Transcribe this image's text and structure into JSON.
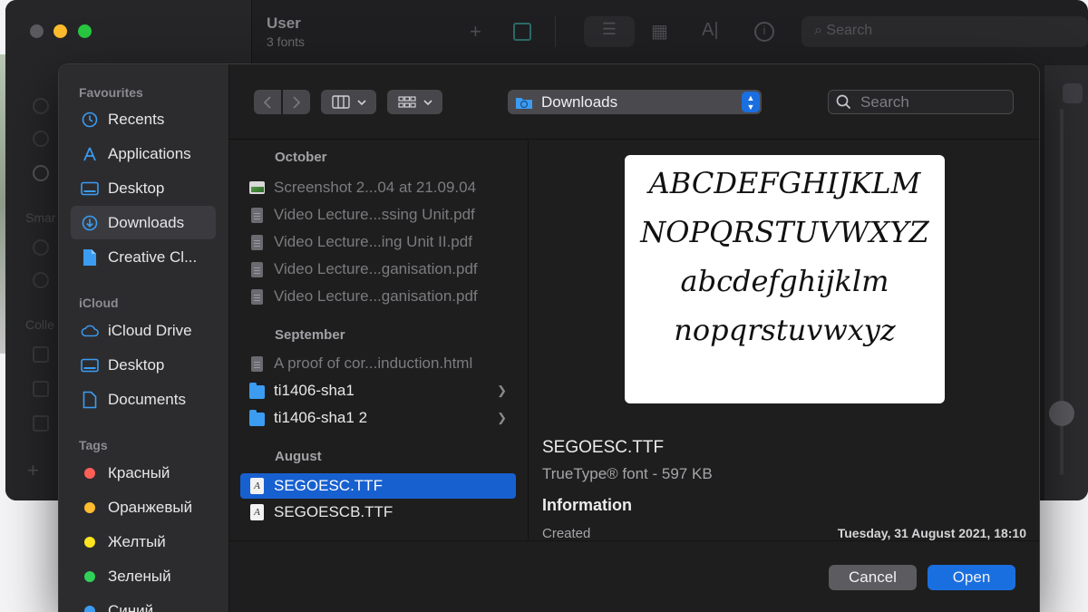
{
  "background_window": {
    "title": "User",
    "subtitle": "3 fonts",
    "search_placeholder": "Search"
  },
  "dialog": {
    "sidebar": {
      "sections": [
        {
          "label": "Favourites",
          "items": [
            {
              "label": "Recents",
              "icon": "clock-icon"
            },
            {
              "label": "Applications",
              "icon": "applications-icon"
            },
            {
              "label": "Desktop",
              "icon": "desktop-icon"
            },
            {
              "label": "Downloads",
              "icon": "downloads-icon",
              "selected": true
            },
            {
              "label": "Creative Cl...",
              "icon": "file-icon"
            }
          ]
        },
        {
          "label": "iCloud",
          "items": [
            {
              "label": "iCloud Drive",
              "icon": "cloud-icon"
            },
            {
              "label": "Desktop",
              "icon": "desktop-icon"
            },
            {
              "label": "Documents",
              "icon": "document-icon"
            }
          ]
        },
        {
          "label": "Tags",
          "items": [
            {
              "label": "Красный",
              "color": "#ff5f57"
            },
            {
              "label": "Оранжевый",
              "color": "#febc2e"
            },
            {
              "label": "Желтый",
              "color": "#ffe41f"
            },
            {
              "label": "Зеленый",
              "color": "#30d158"
            },
            {
              "label": "Синий",
              "color": "#3b9cf2"
            }
          ]
        }
      ]
    },
    "toolbar": {
      "back_icon": "chevron-left-icon",
      "forward_icon": "chevron-right-icon",
      "view_icon": "columns-view-icon",
      "group_icon": "grid-icon",
      "location": "Downloads",
      "search_placeholder": "Search"
    },
    "file_list": {
      "groups": [
        {
          "label": "October",
          "files": [
            {
              "name": "Screenshot 2...04 at 21.09.04",
              "kind": "image",
              "dim": true
            },
            {
              "name": "Video Lecture...ssing Unit.pdf",
              "kind": "doc",
              "dim": true
            },
            {
              "name": "Video Lecture...ing Unit II.pdf",
              "kind": "doc",
              "dim": true
            },
            {
              "name": "Video Lecture...ganisation.pdf",
              "kind": "doc",
              "dim": true
            },
            {
              "name": "Video Lecture...ganisation.pdf",
              "kind": "doc",
              "dim": true
            }
          ]
        },
        {
          "label": "September",
          "files": [
            {
              "name": "A proof of cor...induction.html",
              "kind": "doc",
              "dim": true
            },
            {
              "name": "ti1406-sha1",
              "kind": "folder",
              "dim": false
            },
            {
              "name": "ti1406-sha1 2",
              "kind": "folder",
              "dim": false
            }
          ]
        },
        {
          "label": "August",
          "files": [
            {
              "name": "SEGOESC.TTF",
              "kind": "font",
              "selected": true
            },
            {
              "name": "SEGOESCB.TTF",
              "kind": "font"
            }
          ]
        }
      ]
    },
    "preview": {
      "sample_lines": [
        "ABCDEFGHIJKLM",
        "NOPQRSTUVWXYZ",
        "abcdefghijklm",
        "nopqrstuvwxyz"
      ],
      "file_name": "SEGOESC.TTF",
      "file_kind": "TrueType® font - 597 KB",
      "info_heading": "Information",
      "created_label": "Created",
      "created_value": "Tuesday, 31 August 2021, 18:10"
    },
    "buttons": {
      "cancel": "Cancel",
      "open": "Open"
    },
    "colors": {
      "accent": "#1760d0",
      "button_primary": "#1a6fe0"
    }
  }
}
